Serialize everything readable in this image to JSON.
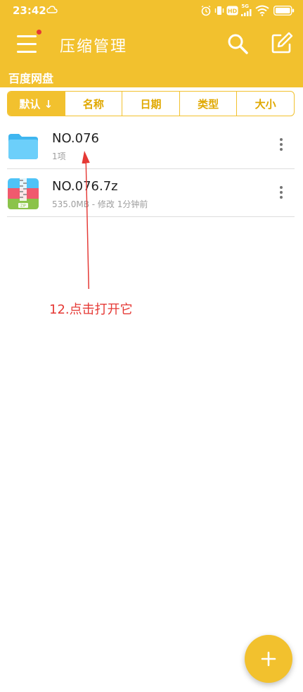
{
  "status_bar": {
    "time": "23:42",
    "network": "5G",
    "icons": [
      "cloud-sync-icon",
      "alarm-icon",
      "vibrate-icon",
      "hd-icon",
      "signal-icon",
      "wifi-icon",
      "battery-icon"
    ]
  },
  "app_bar": {
    "title": "压缩管理",
    "menu_icon": "hamburger-menu-icon",
    "search_icon": "search-icon",
    "edit_icon": "edit-icon"
  },
  "breadcrumb": "百度网盘",
  "sort_tabs": [
    {
      "label": "默认 ↓",
      "active": true
    },
    {
      "label": "名称",
      "active": false
    },
    {
      "label": "日期",
      "active": false
    },
    {
      "label": "类型",
      "active": false
    },
    {
      "label": "大小",
      "active": false
    }
  ],
  "files": [
    {
      "name": "NO.076",
      "meta": "1项",
      "icon": "folder-icon"
    },
    {
      "name": "NO.076.7z",
      "meta": "535.0MB - 修改 1分钟前",
      "icon": "zip-archive-icon"
    }
  ],
  "annotation": {
    "text": "12.点击打开它",
    "color": "#E53935"
  },
  "fab": {
    "icon": "plus-icon"
  },
  "colors": {
    "accent": "#F2C12E",
    "annotation": "#E53935"
  }
}
